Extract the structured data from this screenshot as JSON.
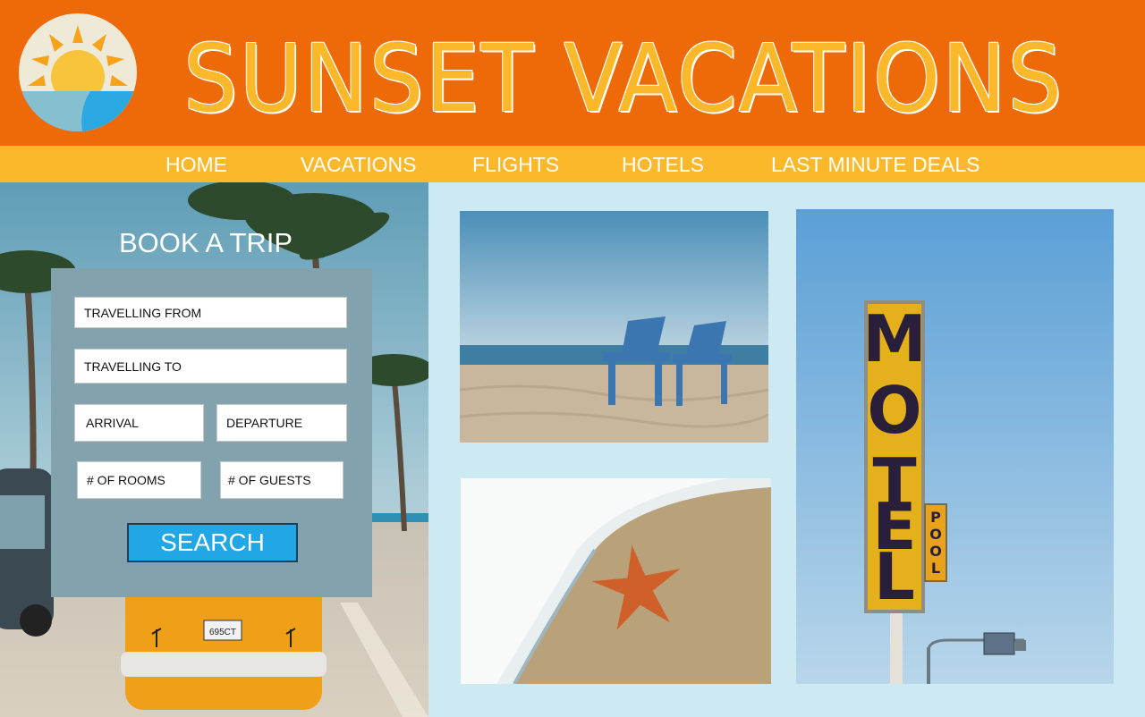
{
  "brand": {
    "name": "SUNSET VACATIONS",
    "logo_icon": "sun-over-sea-logo-icon"
  },
  "nav": {
    "items": [
      {
        "label": "HOME"
      },
      {
        "label": "VACATIONS"
      },
      {
        "label": "FLIGHTS"
      },
      {
        "label": "HOTELS"
      },
      {
        "label": "LAST MINUTE DEALS"
      }
    ]
  },
  "booking": {
    "title": "BOOK A TRIP",
    "fields": {
      "from": "TRAVELLING FROM",
      "to": "TRAVELLING TO",
      "arrival": "ARRIVAL",
      "departure": "DEPARTURE",
      "rooms": "# OF ROOMS",
      "guests": "# OF GUESTS"
    },
    "search_label": "SEARCH"
  },
  "photos": {
    "motel_sign": "MOTEL",
    "pool_sign": "POOL",
    "license_plate": "695CT"
  },
  "colors": {
    "header": "#ee6a09",
    "nav": "#fbb82b",
    "title_text": "#fbb82b",
    "panel": "#82a3ae",
    "search_button": "#21a7e6",
    "page_background": "#cdeaf3"
  }
}
